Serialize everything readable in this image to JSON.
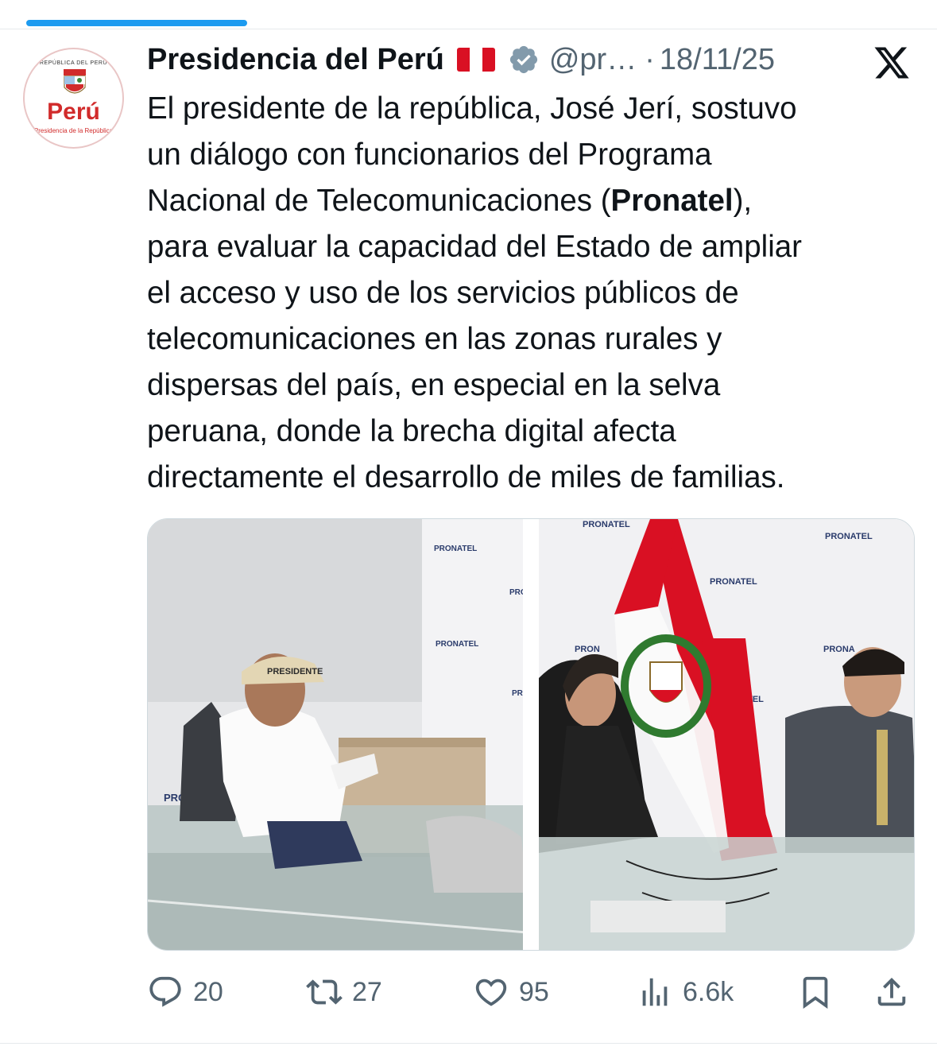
{
  "tweet": {
    "author_name": "Presidencia del Perú",
    "handle": "@pr…",
    "separator": "·",
    "date": "18/11/25",
    "text_lines": [
      [
        "El presidente de la república, José Jerí, sostuvo"
      ],
      [
        "un diálogo con funcionarios del Programa"
      ],
      [
        "Nacional de Telecomunicaciones (",
        "Pronatel",
        "),"
      ],
      [
        "para evaluar la capacidad del Estado de ampliar"
      ],
      [
        "el acceso y uso de los servicios públicos de"
      ],
      [
        "telecomunicaciones en las zonas rurales y"
      ],
      [
        "dispersas del país, en especial en la selva"
      ],
      [
        "peruana, donde la brecha digital afecta"
      ],
      [
        "directamente el desarrollo de miles de familias."
      ]
    ]
  },
  "avatar": {
    "arc_text": "REPÚBLICA DEL PERÚ",
    "wordmark": "Perú",
    "subtitle": "Presidencia de la República"
  },
  "photos": {
    "left_wall_logos": [
      "PRONATEL",
      "PRO",
      "PRONATEL",
      "PR"
    ],
    "left_cap_text": "PRESIDENTE",
    "left_table_text": "PRO   ATE",
    "right_wall_logos": [
      "PRONATEL",
      "PRONATEL",
      "PRONATEL",
      "PRONA",
      "PRON",
      "ATEL"
    ]
  },
  "actions": {
    "replies": "20",
    "reposts": "27",
    "likes": "95",
    "views": "6.6k"
  },
  "icons": {
    "flag": "peru-flag-icon",
    "verified": "verified-badge-icon",
    "platform": "x-logo-icon",
    "reply": "reply-icon",
    "repost": "repost-icon",
    "like": "heart-icon",
    "views": "views-icon",
    "bookmark": "bookmark-icon",
    "share": "share-icon"
  },
  "colors": {
    "accent": "#1d9bf0",
    "text": "#0f1419",
    "muted": "#536471",
    "peru_red": "#d91023"
  }
}
